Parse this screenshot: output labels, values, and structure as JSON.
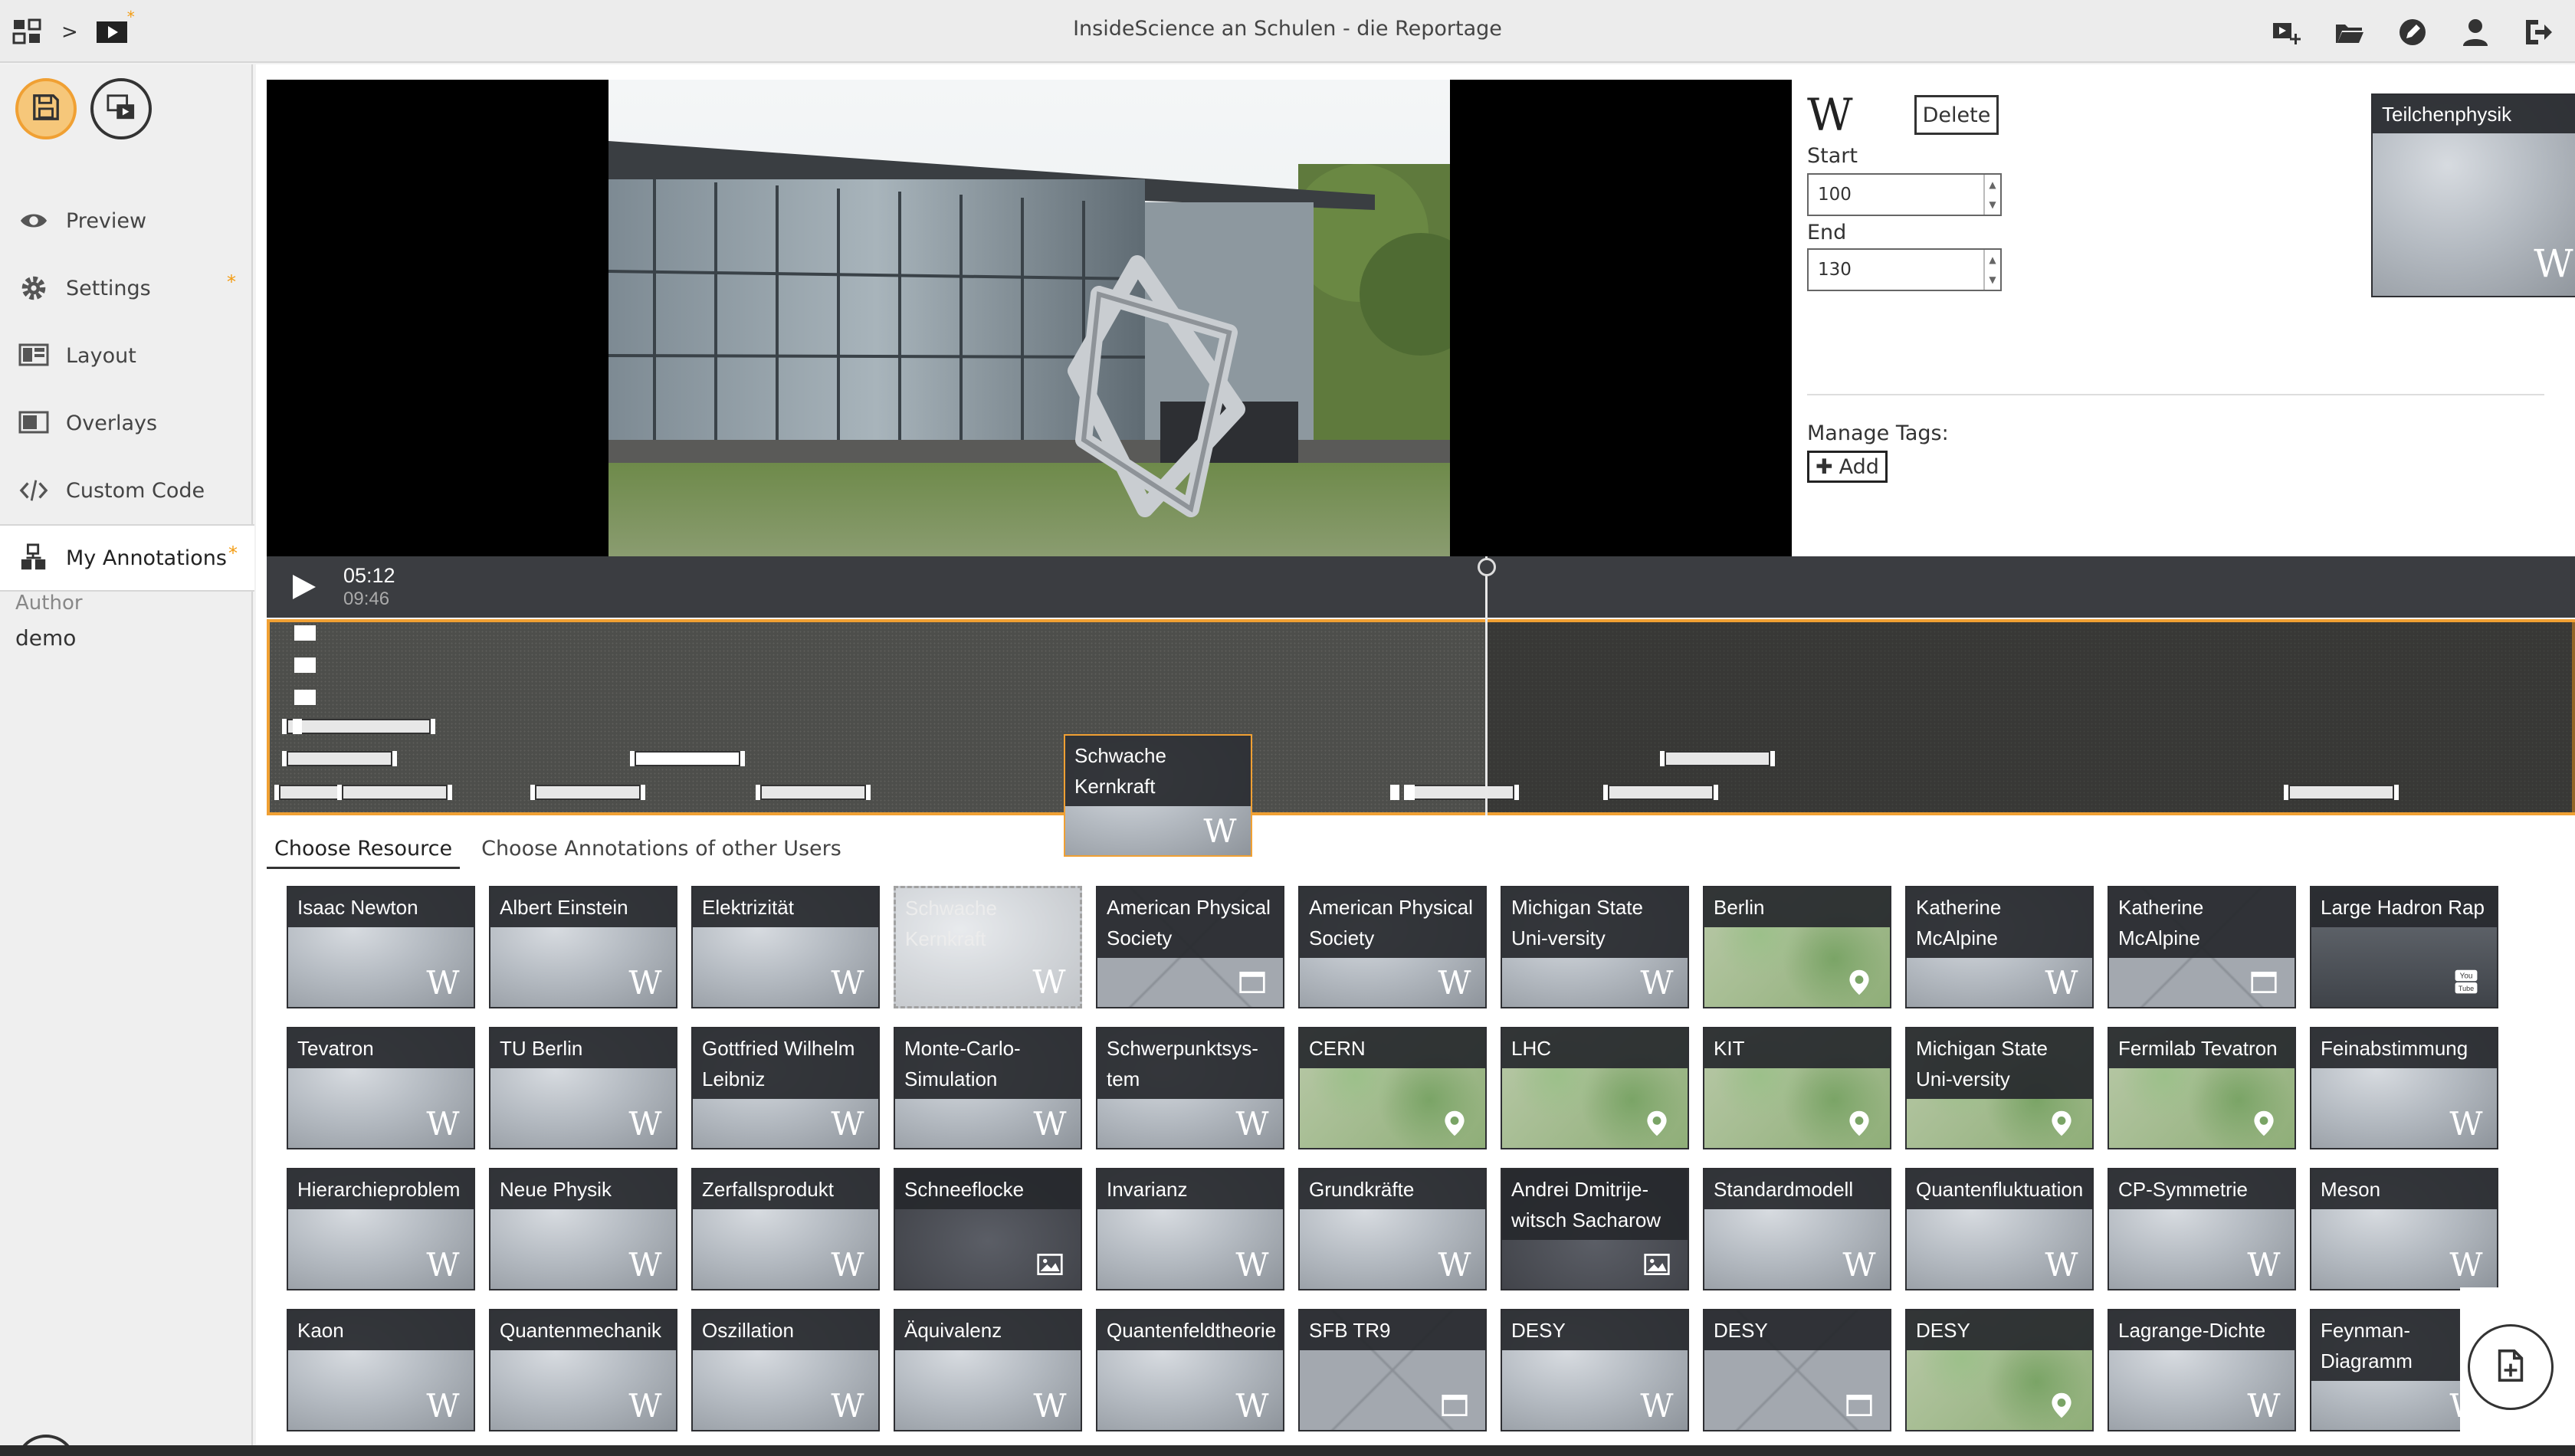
{
  "app": {
    "title": "InsideScience an Schulen - die Reportage"
  },
  "breadcrumb": {
    "separator": ">"
  },
  "sidebar": {
    "items": [
      {
        "label": "Preview",
        "icon": "eye-icon",
        "modified": false
      },
      {
        "label": "Settings",
        "icon": "gear-icon",
        "modified": true
      },
      {
        "label": "Layout",
        "icon": "layout-icon",
        "modified": false
      },
      {
        "label": "Overlays",
        "icon": "overlays-icon",
        "modified": false
      },
      {
        "label": "Custom Code",
        "icon": "code-icon",
        "modified": false
      },
      {
        "label": "My Annotations",
        "icon": "annotations-icon",
        "modified": true
      }
    ],
    "modified_marker": "*",
    "author_label": "Author",
    "author_value": "demo"
  },
  "player": {
    "current_time": "05:12",
    "duration": "09:46",
    "progress_fraction": 0.532
  },
  "editor": {
    "delete_label": "Delete",
    "start_label": "Start",
    "start_value": "100",
    "end_label": "End",
    "end_value": "130",
    "manage_tags_label": "Manage Tags:",
    "add_label": "Add",
    "preview_title": "Teilchenphysik"
  },
  "timeline": {
    "drag_card_title": "Schwache Kernkraft"
  },
  "tabs": {
    "choose_resource": "Choose Resource",
    "choose_other": "Choose Annotations of other Users"
  },
  "resources": [
    {
      "title": "Isaac Newton",
      "type": "wiki"
    },
    {
      "title": "Albert Einstein",
      "type": "wiki"
    },
    {
      "title": "Elektrizität",
      "type": "wiki"
    },
    {
      "title": "Schwache Kernkraft",
      "type": "wiki",
      "ghost": true
    },
    {
      "title": "American Physical Society",
      "type": "web"
    },
    {
      "title": "American Physical Society",
      "type": "wiki"
    },
    {
      "title": "Michigan State Uni-versity",
      "type": "wiki"
    },
    {
      "title": "Berlin",
      "type": "map"
    },
    {
      "title": "Katherine McAlpine",
      "type": "wiki"
    },
    {
      "title": "Katherine McAlpine",
      "type": "web"
    },
    {
      "title": "Large Hadron Rap",
      "type": "youtube"
    },
    {
      "title": "Tevatron",
      "type": "wiki"
    },
    {
      "title": "TU Berlin",
      "type": "wiki"
    },
    {
      "title": "Gottfried Wilhelm Leibniz",
      "type": "wiki"
    },
    {
      "title": "Monte-Carlo-Simulation",
      "type": "wiki"
    },
    {
      "title": "Schwerpunktsys-tem",
      "type": "wiki"
    },
    {
      "title": "CERN",
      "type": "map"
    },
    {
      "title": "LHC",
      "type": "map"
    },
    {
      "title": "KIT",
      "type": "map"
    },
    {
      "title": "Michigan State Uni-versity",
      "type": "map"
    },
    {
      "title": "Fermilab Tevatron",
      "type": "map"
    },
    {
      "title": "Feinabstimmung",
      "type": "wiki"
    },
    {
      "title": "Hierarchieproblem",
      "type": "wiki"
    },
    {
      "title": "Neue Physik",
      "type": "wiki"
    },
    {
      "title": "Zerfallsprodukt",
      "type": "wiki"
    },
    {
      "title": "Schneeflocke",
      "type": "image"
    },
    {
      "title": "Invarianz",
      "type": "wiki"
    },
    {
      "title": "Grundkräfte",
      "type": "wiki"
    },
    {
      "title": "Andrei Dmitrije-witsch Sacharow",
      "type": "image"
    },
    {
      "title": "Standardmodell",
      "type": "wiki"
    },
    {
      "title": "Quantenfluktuation",
      "type": "wiki"
    },
    {
      "title": "CP-Symmetrie",
      "type": "wiki"
    },
    {
      "title": "Meson",
      "type": "wiki"
    },
    {
      "title": "Kaon",
      "type": "wiki"
    },
    {
      "title": "Quantenmechanik",
      "type": "wiki"
    },
    {
      "title": "Oszillation",
      "type": "wiki"
    },
    {
      "title": "Äquivalenz",
      "type": "wiki"
    },
    {
      "title": "Quantenfeldtheorie",
      "type": "wiki"
    },
    {
      "title": "SFB TR9",
      "type": "web"
    },
    {
      "title": "DESY",
      "type": "wiki"
    },
    {
      "title": "DESY",
      "type": "web"
    },
    {
      "title": "DESY",
      "type": "map"
    },
    {
      "title": "Lagrange-Dichte",
      "type": "wiki"
    },
    {
      "title": "Feynman-Diagramm",
      "type": "wiki"
    }
  ],
  "colors": {
    "accent": "#f0a033",
    "dark_header": "#26282d",
    "timeline_bg": "#4d4e4b",
    "map_green": "#7fa86a"
  }
}
